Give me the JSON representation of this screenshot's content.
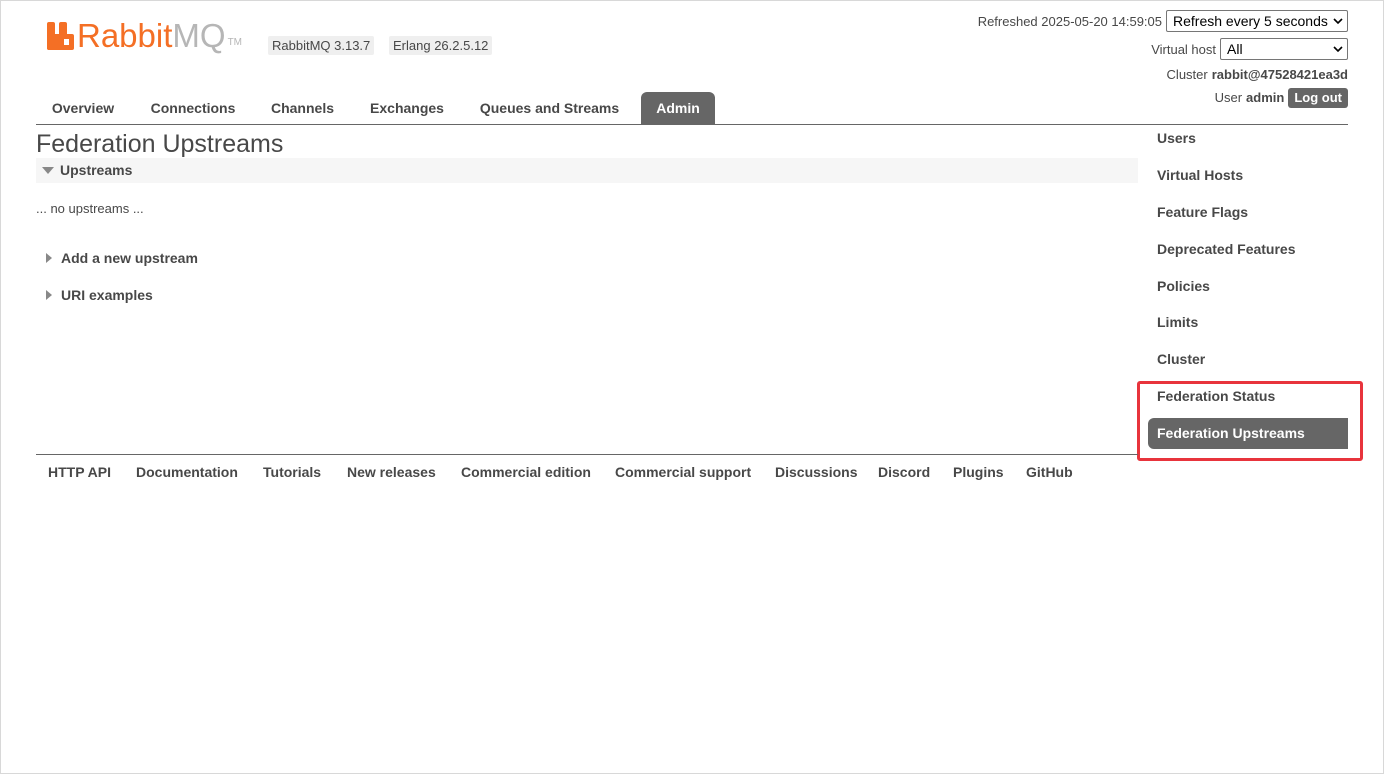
{
  "brand": {
    "name_primary": "Rabbit",
    "name_secondary": "MQ",
    "tm": "TM"
  },
  "versions": {
    "rabbitmq": "RabbitMQ 3.13.7",
    "erlang": "Erlang 26.2.5.12"
  },
  "top_right": {
    "refreshed_label": "Refreshed 2025-05-20 14:59:05",
    "refresh_select": "Refresh every 5 seconds",
    "vhost_label": "Virtual host",
    "vhost_select": "All",
    "cluster_label": "Cluster",
    "cluster_name": "rabbit@47528421ea3d",
    "user_label": "User",
    "user_name": "admin",
    "logout": "Log out"
  },
  "tabs": [
    {
      "label": "Overview"
    },
    {
      "label": "Connections"
    },
    {
      "label": "Channels"
    },
    {
      "label": "Exchanges"
    },
    {
      "label": "Queues and Streams"
    },
    {
      "label": "Admin",
      "active": true
    }
  ],
  "main": {
    "title": "Federation Upstreams",
    "section_label": "Upstreams",
    "empty_text": "... no upstreams ...",
    "add_upstream": "Add a new upstream",
    "uri_examples": "URI examples"
  },
  "admin_nav": [
    {
      "label": "Users"
    },
    {
      "label": "Virtual Hosts"
    },
    {
      "label": "Feature Flags"
    },
    {
      "label": "Deprecated Features"
    },
    {
      "label": "Policies"
    },
    {
      "label": "Limits"
    },
    {
      "label": "Cluster"
    },
    {
      "label": "Federation Status"
    },
    {
      "label": "Federation Upstreams",
      "active": true
    }
  ],
  "footer": [
    {
      "label": "HTTP API"
    },
    {
      "label": "Documentation"
    },
    {
      "label": "Tutorials"
    },
    {
      "label": "New releases"
    },
    {
      "label": "Commercial edition"
    },
    {
      "label": "Commercial support"
    },
    {
      "label": "Discussions"
    },
    {
      "label": "Discord"
    },
    {
      "label": "Plugins"
    },
    {
      "label": "GitHub"
    }
  ],
  "colors": {
    "brand_orange": "#f46f25",
    "active_tab": "#666666",
    "highlight": "#e8343c"
  }
}
